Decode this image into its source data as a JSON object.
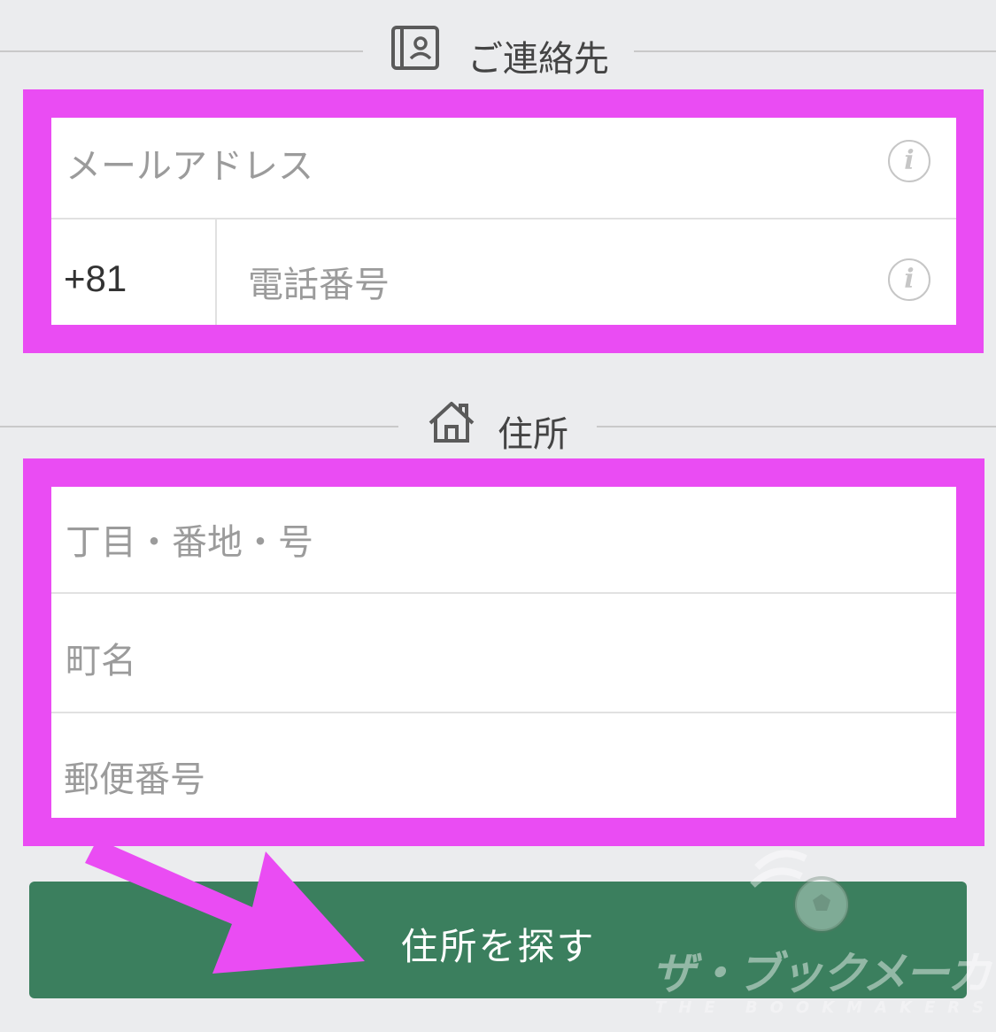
{
  "contact_section": {
    "title": "ご連絡先",
    "icon": "contact-card-icon",
    "email_placeholder": "メールアドレス",
    "phone_prefix": "+81",
    "phone_placeholder": "電話番号",
    "info_icon_glyph": "i"
  },
  "address_section": {
    "title": "住所",
    "icon": "home-icon",
    "street_placeholder": "丁目・番地・号",
    "town_placeholder": "町名",
    "postal_placeholder": "郵便番号"
  },
  "actions": {
    "search_address_label": "住所を探す"
  },
  "watermark": {
    "text": "ザ・ブックメーカーズ",
    "sub": "THE BOOKMAKERS"
  },
  "colors": {
    "background": "#ebecee",
    "highlight": "#ea4cf3",
    "button": "#3b7f5e"
  }
}
